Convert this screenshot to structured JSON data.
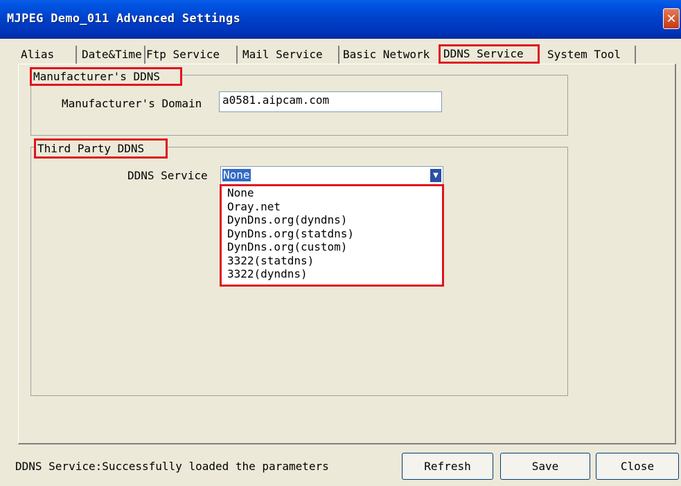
{
  "window": {
    "title": "MJPEG Demo_011 Advanced Settings",
    "close_glyph": "✕"
  },
  "tabs": [
    {
      "label": "Alias"
    },
    {
      "label": "Date&Time"
    },
    {
      "label": "Ftp Service"
    },
    {
      "label": "Mail Service"
    },
    {
      "label": "Basic Network"
    },
    {
      "label": "DDNS Service",
      "active": true
    },
    {
      "label": "System Tool"
    }
  ],
  "manufacturer_ddns": {
    "legend": "Manufacturer's DDNS",
    "domain_label": "Manufacturer's Domain",
    "domain_value": "a0581.aipcam.com"
  },
  "third_party_ddns": {
    "legend": "Third Party DDNS",
    "service_label": "DDNS Service",
    "service_value": "None",
    "arrow_glyph": "▼",
    "options": [
      "None",
      "Oray.net",
      "DynDns.org(dyndns)",
      "DynDns.org(statdns)",
      "DynDns.org(custom)",
      "3322(statdns)",
      "3322(dyndns)"
    ]
  },
  "status": {
    "text": "DDNS Service:Successfully loaded the parameters"
  },
  "buttons": {
    "refresh": "Refresh",
    "save": "Save",
    "close": "Close"
  },
  "colors": {
    "title_bar": "#0040c8",
    "highlight_box": "#e0141e",
    "selection": "#316ac5"
  }
}
